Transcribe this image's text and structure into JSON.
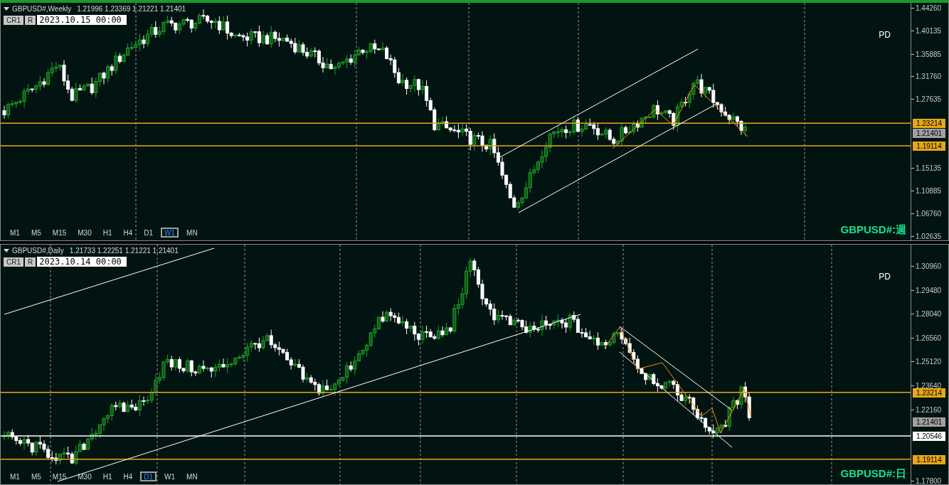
{
  "panels": [
    {
      "title": "GBPUSD#,Weekly",
      "ohlc": "1.21996 1.23369 1.21221 1.21401",
      "buttons": [
        "CR1",
        "R"
      ],
      "date": "2023.10.15 00:00",
      "pd": "PD",
      "symbol_label": "GBPUSD#:週",
      "timeframes": [
        {
          "label": "M1",
          "selected": false
        },
        {
          "label": "M5",
          "selected": false
        },
        {
          "label": "M15",
          "selected": false
        },
        {
          "label": "M30",
          "selected": false
        },
        {
          "label": "H1",
          "selected": false
        },
        {
          "label": "H4",
          "selected": false
        },
        {
          "label": "D1",
          "selected": false
        },
        {
          "label": "W1",
          "selected": true
        },
        {
          "label": "MN",
          "selected": false
        }
      ],
      "axis_labels": [
        "1.44260",
        "1.40135",
        "1.35885",
        "1.31760",
        "1.27635",
        "1.15135",
        "1.10885",
        "1.06760",
        "1.02635"
      ],
      "levels": [
        {
          "kind": "level",
          "price": "1.23214",
          "color": "#e6a817"
        },
        {
          "kind": "bid",
          "price": "1.21401",
          "color": "#a0a0a0"
        },
        {
          "kind": "level",
          "price": "1.19114",
          "color": "#e6a817"
        }
      ]
    },
    {
      "title": "GBPUSD#,Daily",
      "ohlc": "1.21733 1.22251 1.21221 1.21401",
      "buttons": [
        "CR1",
        "R"
      ],
      "date": "2023.10.14 00:00",
      "pd": "PD",
      "symbol_label": "GBPUSD#:日",
      "timeframes": [
        {
          "label": "M1",
          "selected": false
        },
        {
          "label": "M5",
          "selected": false
        },
        {
          "label": "M15",
          "selected": false
        },
        {
          "label": "M30",
          "selected": false
        },
        {
          "label": "H1",
          "selected": false
        },
        {
          "label": "H4",
          "selected": false
        },
        {
          "label": "D1",
          "selected": true
        },
        {
          "label": "W1",
          "selected": false
        },
        {
          "label": "MN",
          "selected": false
        }
      ],
      "axis_labels": [
        "1.30960",
        "1.29480",
        "1.28040",
        "1.26560",
        "1.25120",
        "1.23640",
        "1.22160",
        "1.17800"
      ],
      "levels": [
        {
          "kind": "level",
          "price": "1.23214",
          "color": "#e6a817"
        },
        {
          "kind": "bid",
          "price": "1.21401",
          "color": "#a0a0a0"
        },
        {
          "kind": "level",
          "price": "1.20546",
          "color": "#ffffff"
        },
        {
          "kind": "level",
          "price": "1.19114",
          "color": "#e6a817"
        }
      ]
    }
  ]
}
